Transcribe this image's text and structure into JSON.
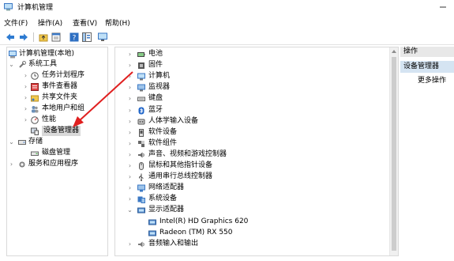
{
  "window": {
    "title": "计算机管理"
  },
  "menu": [
    "文件(F)",
    "操作(A)",
    "查看(V)",
    "帮助(H)"
  ],
  "toolbar_icons": [
    "back-arrow-icon",
    "forward-arrow-icon",
    "folder-up-icon",
    "properties-icon",
    "help-icon",
    "show-hide-icon",
    "monitor-icon"
  ],
  "tree": {
    "root": "计算机管理(本地)",
    "system_tools": "系统工具",
    "task_scheduler": "任务计划程序",
    "event_viewer": "事件查看器",
    "shared_folders": "共享文件夹",
    "local_users": "本地用户和组",
    "performance": "性能",
    "device_manager": "设备管理器",
    "storage": "存储",
    "disk_management": "磁盘管理",
    "services_apps": "服务和应用程序"
  },
  "devices": [
    {
      "label": "电池",
      "icon": "battery-icon"
    },
    {
      "label": "固件",
      "icon": "firmware-icon"
    },
    {
      "label": "计算机",
      "icon": "computer-icon"
    },
    {
      "label": "监视器",
      "icon": "monitor-icon"
    },
    {
      "label": "键盘",
      "icon": "keyboard-icon"
    },
    {
      "label": "蓝牙",
      "icon": "bluetooth-icon"
    },
    {
      "label": "人体学输入设备",
      "icon": "hid-icon"
    },
    {
      "label": "软件设备",
      "icon": "software-device-icon"
    },
    {
      "label": "软件组件",
      "icon": "software-component-icon"
    },
    {
      "label": "声音、视频和游戏控制器",
      "icon": "sound-icon"
    },
    {
      "label": "鼠标和其他指针设备",
      "icon": "mouse-icon"
    },
    {
      "label": "通用串行总线控制器",
      "icon": "usb-icon"
    },
    {
      "label": "网络适配器",
      "icon": "network-icon"
    },
    {
      "label": "系统设备",
      "icon": "system-device-icon"
    },
    {
      "label": "显示适配器",
      "icon": "display-adapter-icon"
    },
    {
      "label": "Intel(R) HD Graphics 620",
      "icon": "display-adapter-icon"
    },
    {
      "label": "Radeon (TM) RX 550",
      "icon": "display-adapter-icon"
    },
    {
      "label": "音频输入和输出",
      "icon": "audio-icon"
    }
  ],
  "actions": {
    "header": "操作",
    "selected": "设备管理器",
    "more": "更多操作"
  },
  "colors": {
    "selection": "#d5e4f2",
    "arrow": "#e02020",
    "icon_blue": "#3b78c4"
  }
}
